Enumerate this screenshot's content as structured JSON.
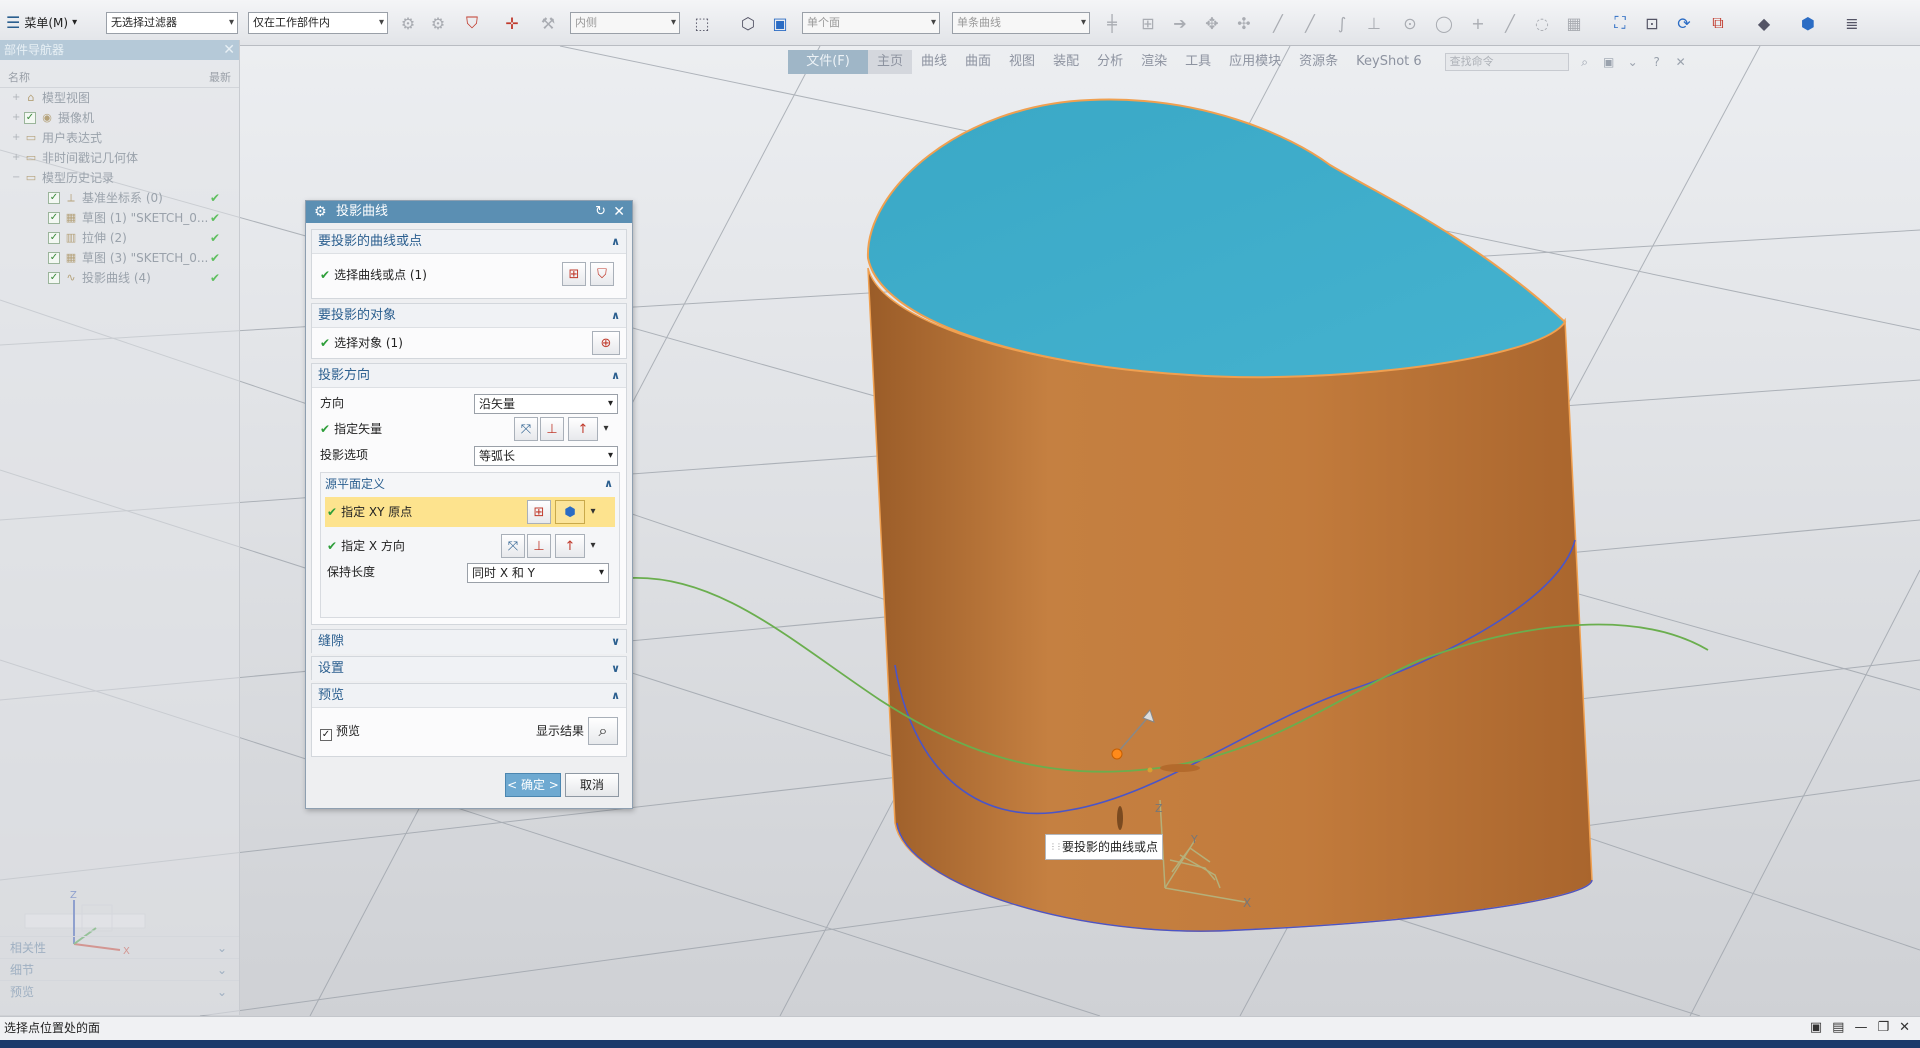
{
  "toolbar": {
    "menu_label": "菜单(M)",
    "filter_combo": "无选择过滤器",
    "scope_combo": "仅在工作部件内",
    "side_combo": "内侧",
    "face_rule_combo": "单个面",
    "curve_rule_combo": "单条曲线"
  },
  "ribbon": {
    "tabs": [
      "文件(F)",
      "主页",
      "曲线",
      "曲面",
      "视图",
      "装配",
      "分析",
      "渲染",
      "工具",
      "应用模块",
      "资源条",
      "KeyShot 6"
    ],
    "active_tab": "主页",
    "search_placeholder": "查找命令"
  },
  "navigator": {
    "title": "部件导航器",
    "col_name": "名称",
    "col_latest": "最新",
    "items": [
      {
        "label": "模型视图",
        "level": 0,
        "icon": "view-icon",
        "checked": false
      },
      {
        "label": "摄像机",
        "level": 0,
        "icon": "camera-icon",
        "checked": true
      },
      {
        "label": "用户表达式",
        "level": 0,
        "icon": "folder-icon",
        "checked": false
      },
      {
        "label": "非时间戳记几何体",
        "level": 0,
        "icon": "folder-icon",
        "checked": false
      },
      {
        "label": "模型历史记录",
        "level": 0,
        "icon": "folder-icon",
        "checked": false
      },
      {
        "label": "基准坐标系 (0)",
        "level": 1,
        "icon": "datum-csys-icon",
        "checked": true,
        "ok": true
      },
      {
        "label": "草图 (1) \"SKETCH_0...",
        "level": 1,
        "icon": "sketch-icon",
        "checked": true,
        "ok": true
      },
      {
        "label": "拉伸 (2)",
        "level": 1,
        "icon": "extrude-icon",
        "checked": true,
        "ok": true
      },
      {
        "label": "草图 (3) \"SKETCH_0...",
        "level": 1,
        "icon": "sketch-icon",
        "checked": true,
        "ok": true
      },
      {
        "label": "投影曲线 (4)",
        "level": 1,
        "icon": "project-curve-icon",
        "checked": true,
        "ok": true
      }
    ],
    "bottom_panels": [
      "相关性",
      "细节",
      "预览"
    ]
  },
  "dialog": {
    "title": "投影曲线",
    "sec_curves": "要投影的曲线或点",
    "select_curves": "选择曲线或点 (1)",
    "sec_objects": "要投影的对象",
    "select_objects": "选择对象 (1)",
    "sec_direction": "投影方向",
    "direction_label": "方向",
    "direction_value": "沿矢量",
    "specify_vector": "指定矢量",
    "projection_option_label": "投影选项",
    "projection_option_value": "等弧长",
    "sub_source_plane": "源平面定义",
    "specify_xy_origin": "指定 XY 原点",
    "specify_x_dir": "指定 X 方向",
    "keep_length_label": "保持长度",
    "keep_length_value": "同时 X 和 Y",
    "sec_gap": "缝隙",
    "sec_settings": "设置",
    "sec_preview": "预览",
    "preview_checkbox": "预览",
    "show_result": "显示结果",
    "ok_button": "< 确定 >",
    "cancel_button": "取消"
  },
  "viewport": {
    "tooltip": "要投影的曲线或点",
    "axis_x": "X",
    "axis_y": "Y",
    "axis_z": "Z",
    "colors": {
      "top_face": "#3fadc9",
      "side_face": "#c27b3c",
      "projected_curve": "#4a55c8",
      "sketch_curve": "#6aae4e"
    }
  },
  "status": {
    "message": "选择点位置处的面"
  }
}
